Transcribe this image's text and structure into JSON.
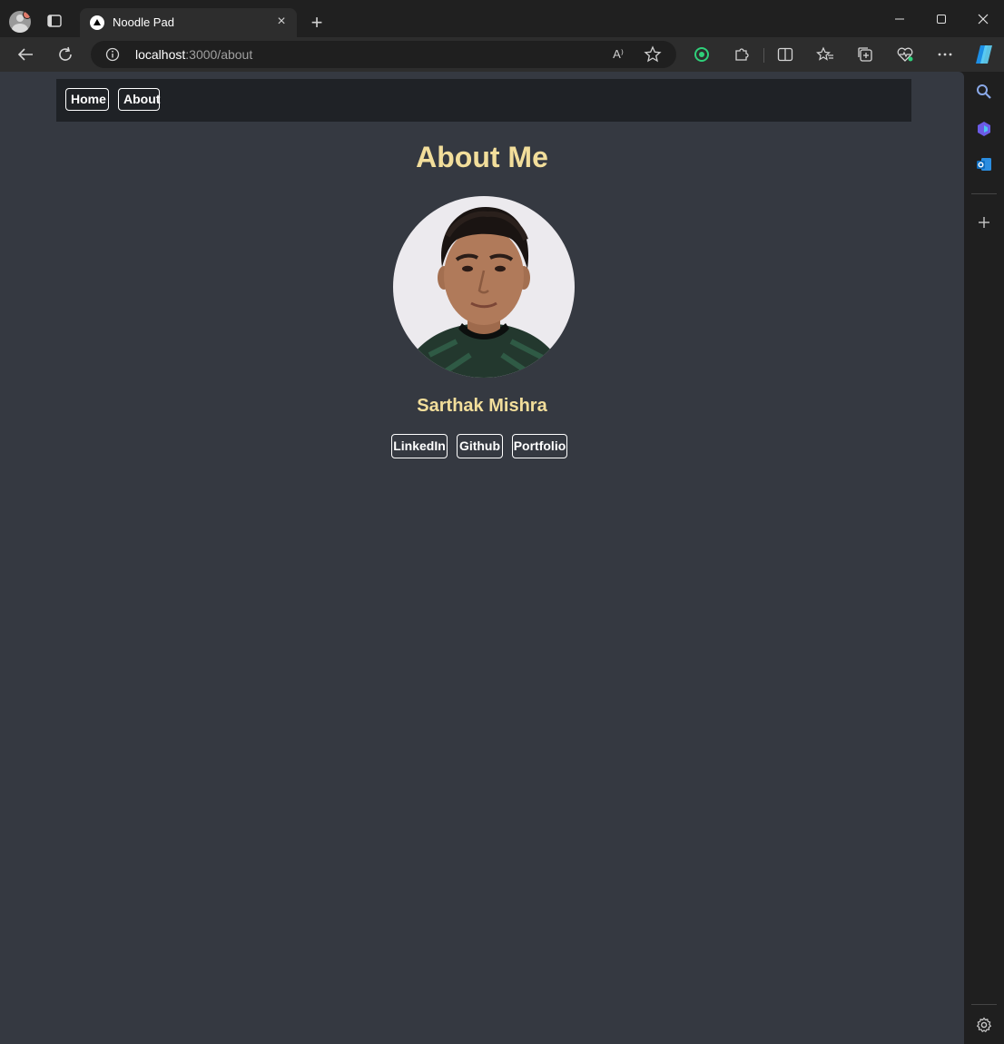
{
  "browser": {
    "tab_title": "Noodle Pad",
    "tab_close": "×",
    "new_tab": "+",
    "url_host": "localhost",
    "url_path": ":3000/about",
    "read_aloud": "A⁾",
    "icons": [
      "profile-icon",
      "tab-actions-icon",
      "site-favicon",
      "close-icon",
      "plus-icon",
      "minimize-icon",
      "maximize-icon",
      "window-close-icon",
      "back-arrow-icon",
      "reload-icon",
      "info-icon",
      "read-aloud-icon",
      "star-icon",
      "extension-icon",
      "puzzle-icon",
      "split-screen-icon",
      "favorites-icon",
      "collections-icon",
      "browser-essentials-icon",
      "more-icon",
      "copilot-icon",
      "search-icon",
      "outlook-icon",
      "gear-icon"
    ]
  },
  "nav": {
    "home": "Home",
    "about": "About"
  },
  "main": {
    "title": "About Me",
    "name": "Sarthak Mishra",
    "links": [
      "LinkedIn",
      "Github",
      "Portfolio"
    ]
  },
  "colors": {
    "page_bg": "#353941",
    "navbar_bg": "#1f2226",
    "accent": "#f2de9b"
  }
}
